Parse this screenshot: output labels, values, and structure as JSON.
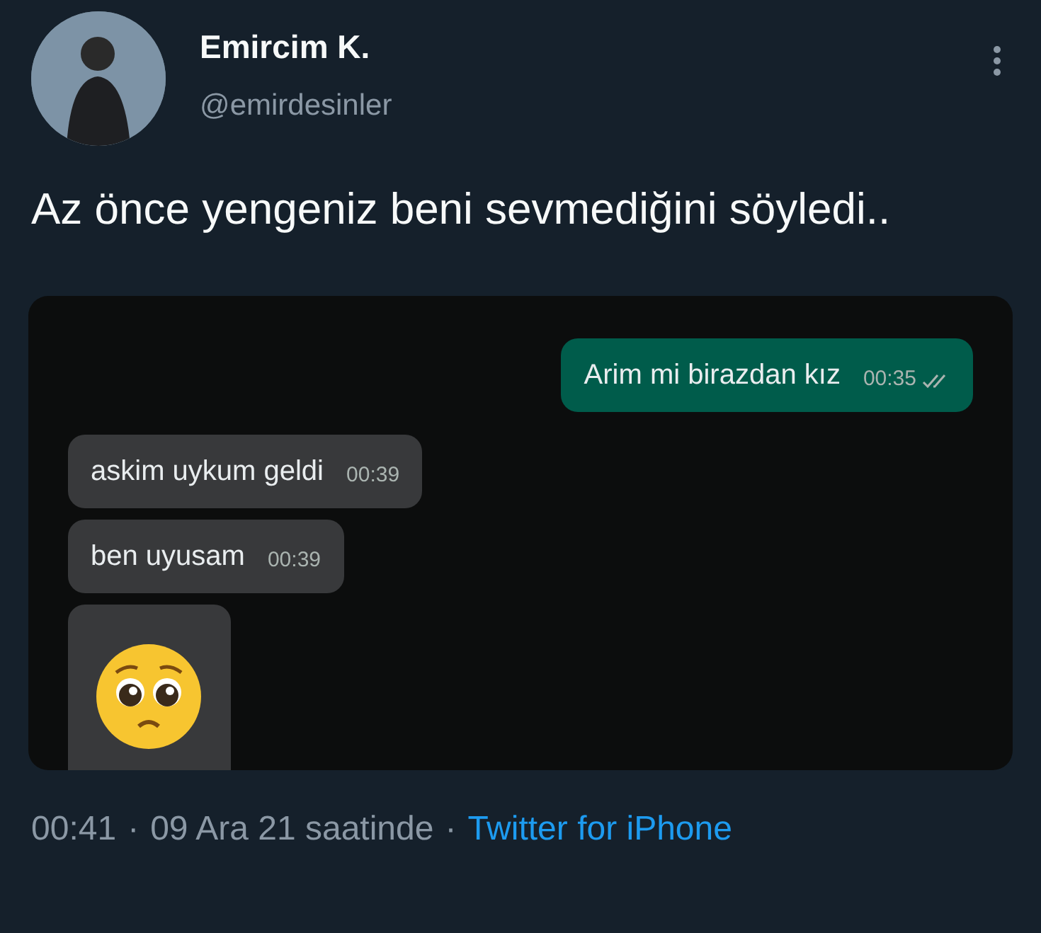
{
  "author": {
    "name": "Emircim K.",
    "handle": "@emirdesinler"
  },
  "text": "Az önce yengeniz beni sevmediğini söyledi..",
  "chat_screenshot": {
    "messages": [
      {
        "kind": "outgoing",
        "text": "Arim mi birazdan kız",
        "time": "00:35"
      },
      {
        "kind": "incoming",
        "text": "askim uykum geldi",
        "time": "00:39"
      },
      {
        "kind": "incoming",
        "text": "ben uyusam",
        "time": "00:39"
      },
      {
        "kind": "emoji"
      }
    ]
  },
  "meta": {
    "time": "00:41",
    "separator_1": "·",
    "date": "09 Ara 21 saatinde",
    "separator_2": "·",
    "source": "Twitter for iPhone"
  }
}
